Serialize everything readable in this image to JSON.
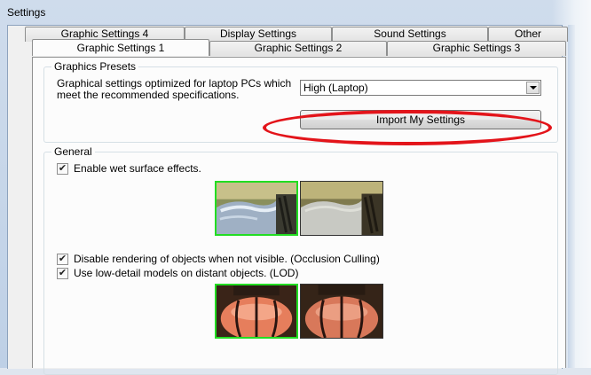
{
  "window": {
    "title": "Settings"
  },
  "tabs": {
    "back_row": [
      {
        "label": "Graphic Settings 4"
      },
      {
        "label": "Display Settings"
      },
      {
        "label": "Sound Settings"
      },
      {
        "label": "Other"
      }
    ],
    "front_row": [
      {
        "label": "Graphic Settings 1",
        "active": true
      },
      {
        "label": "Graphic Settings 2"
      },
      {
        "label": "Graphic Settings 3"
      }
    ]
  },
  "presets": {
    "legend": "Graphics Presets",
    "description": "Graphical settings optimized for laptop PCs which meet the recommended specifications.",
    "dropdown": {
      "value": "High (Laptop)"
    },
    "import_button": "Import My Settings",
    "annotation_color": "#e3141a"
  },
  "general": {
    "legend": "General",
    "options": [
      {
        "label": "Enable wet surface effects.",
        "checked": true
      },
      {
        "label": "Disable rendering of objects when not visible. (Occlusion Culling)",
        "checked": true
      },
      {
        "label": "Use low-detail models on distant objects. (LOD)",
        "checked": true
      }
    ],
    "preview_selection_color": "#22dd22",
    "check_glyph": "✔"
  }
}
